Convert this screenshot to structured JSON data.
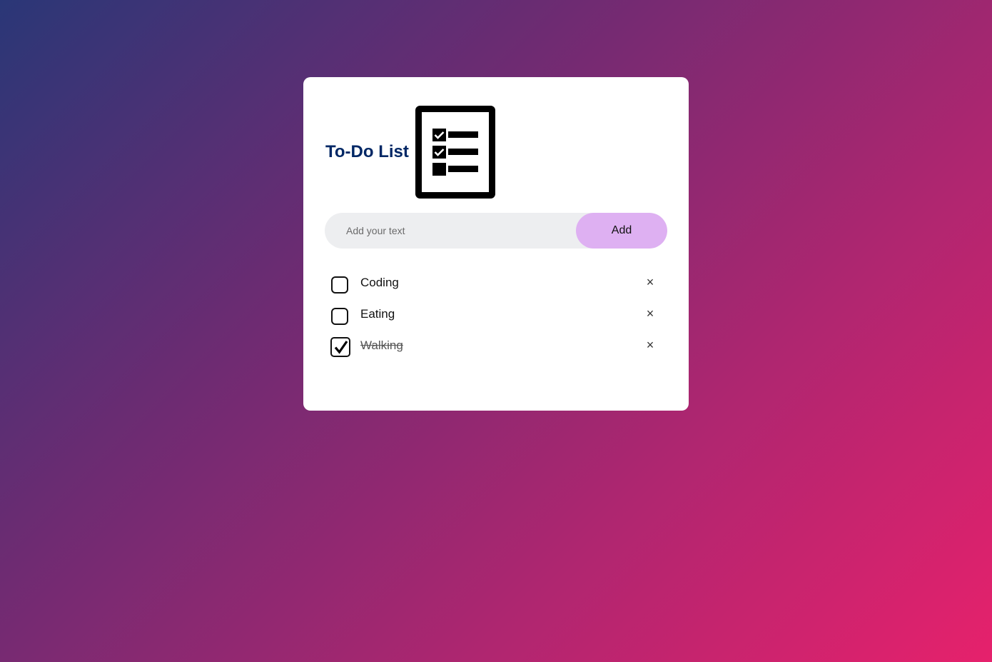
{
  "header": {
    "title": "To-Do List",
    "icon": "checklist-icon"
  },
  "input": {
    "placeholder": "Add your text",
    "value": ""
  },
  "add_button": {
    "label": "Add"
  },
  "tasks": [
    {
      "label": "Coding",
      "checked": false
    },
    {
      "label": "Eating",
      "checked": false
    },
    {
      "label": "Walking",
      "checked": true
    }
  ],
  "delete_glyph": "×",
  "colors": {
    "title": "#002765",
    "add_button_bg": "#deb0f2",
    "input_bg": "#edeef0",
    "gradient_start": "#2a3777",
    "gradient_end": "#e6216c"
  }
}
